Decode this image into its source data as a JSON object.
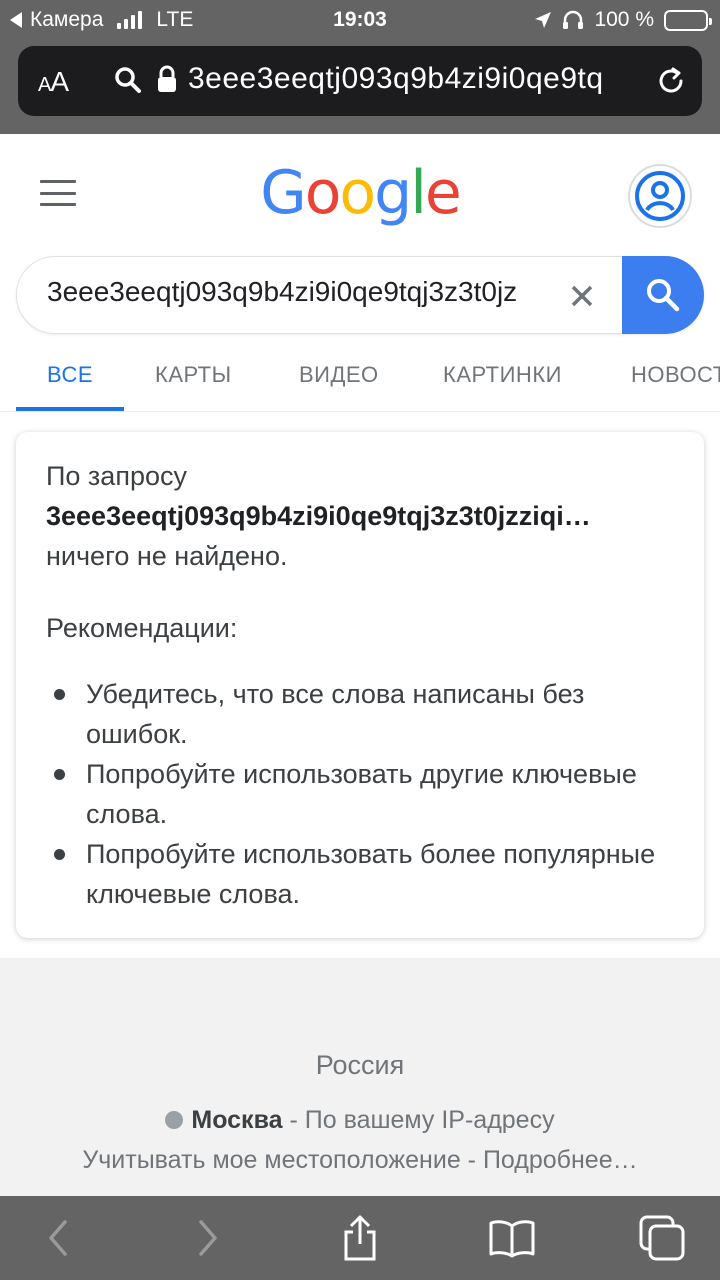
{
  "status_bar": {
    "back_app": "Камера",
    "network": "LTE",
    "time": "19:03",
    "battery": "100 %"
  },
  "url_bar": {
    "text_size_label": "AA",
    "url": "3eee3eeqtj093q9b4zi9i0qe9tq"
  },
  "google": {
    "logo_letters": [
      "G",
      "o",
      "o",
      "g",
      "l",
      "e"
    ]
  },
  "search": {
    "value": "3eee3eeqtj093q9b4zi9i0qe9tqj3z3t0jz"
  },
  "tabs": [
    {
      "label": "ВСЕ",
      "active": true
    },
    {
      "label": "КАРТЫ",
      "active": false
    },
    {
      "label": "ВИДЕО",
      "active": false
    },
    {
      "label": "КАРТИНКИ",
      "active": false
    },
    {
      "label": "НОВОСТИ",
      "active": false
    }
  ],
  "result": {
    "intro": "По запросу",
    "query": "3eee3eeqtj093q9b4zi9i0qe9tqj3z3t0jzziqi…",
    "nothing_found": "ничего не найдено.",
    "recommendations_title": "Рекомендации:",
    "recommendations": [
      "Убедитесь, что все слова написаны без ошибок.",
      "Попробуйте использовать другие ключевые слова.",
      "Попробуйте использовать более популярные ключевые слова."
    ]
  },
  "footer": {
    "country": "Россия",
    "city": "Москва",
    "location_source": " - По вашему IP-адресу",
    "use_location": "Учитывать мое местоположение",
    "separator": " - ",
    "more": "Подробнее…"
  },
  "colors": {
    "accent": "#1a73e8",
    "search_button": "#3c7ef0",
    "chrome": "#646464"
  }
}
